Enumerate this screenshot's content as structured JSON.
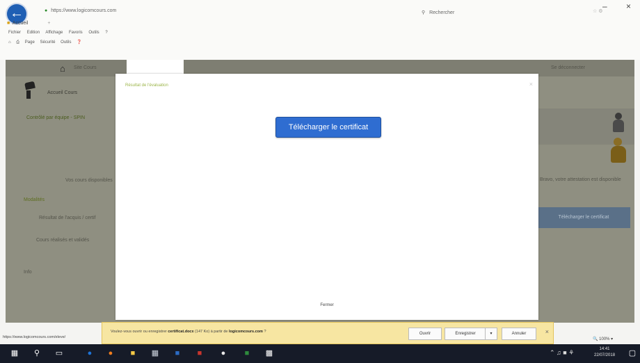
{
  "browser": {
    "url_prefix": "https",
    "url": "://www.logicomcours.com",
    "tab_title": "Accueil",
    "search_placeholder": "Rechercher",
    "menu": [
      "Fichier",
      "Edition",
      "Affichage",
      "Favoris",
      "Outils",
      "?"
    ],
    "commands": [
      "Page",
      "Sécurité",
      "Outils"
    ]
  },
  "page": {
    "home_label": "Site Cours",
    "top_right": "Se déconnecter",
    "user_name": "Accueil Cours",
    "green_line": "Contrôlé par équipe - SPIN",
    "left_blur": "Vos cours disponibles",
    "section_label": "Modalités",
    "line1": "Résultat de l'acquis / certif",
    "line2": "Cours réalisés et validés",
    "line3": "Info",
    "right_text": "Bravo, votre attestation est disponible",
    "right_button": "Télécharger le certificat"
  },
  "modal": {
    "title": "Résultat de l'évaluation",
    "close_x": "×",
    "download_button": "Télécharger le certificat",
    "close_link": "Fermer"
  },
  "download_bar": {
    "prefix": "Voulez-vous ouvrir ou enregistrer",
    "filename": "certificat.docx",
    "size": "(147 Ko)",
    "from": "à partir de",
    "site": "logicomcours.com",
    "ouvrir": "Ouvrir",
    "enregistrer": "Enregistrer",
    "annuler": "Annuler",
    "close": "×"
  },
  "status": {
    "url": "https://www.logicomcours.com/eleve/",
    "zoom": "100%"
  },
  "taskbar": {
    "time": "14:41",
    "date": "22/07/2018"
  }
}
